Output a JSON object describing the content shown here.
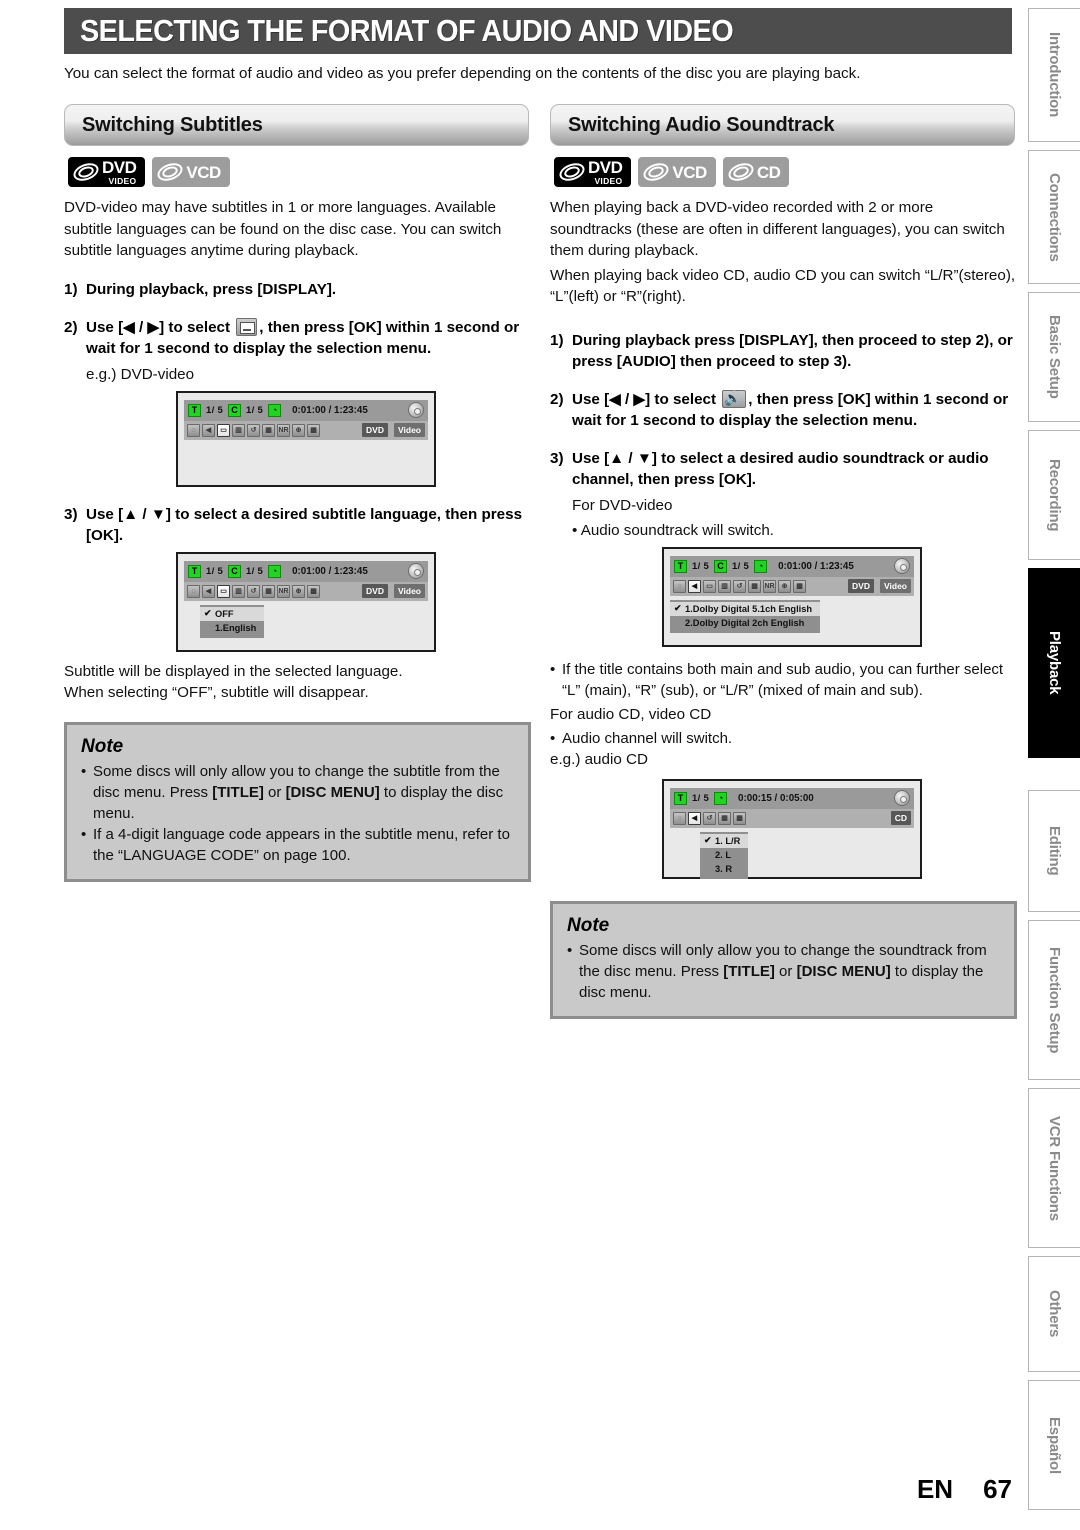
{
  "header": {
    "title": "SELECTING THE FORMAT OF AUDIO AND VIDEO",
    "intro": "You can select the format of audio and video as you prefer depending on the contents of the disc you are playing back."
  },
  "left_column": {
    "section_title": "Switching Subtitles",
    "disc_badges": [
      {
        "main": "DVD",
        "sub": "VIDEO",
        "style": "dark"
      },
      {
        "main": "VCD",
        "sub": "",
        "style": "gray"
      }
    ],
    "intro_paragraph": "DVD-video may have subtitles in 1 or more languages. Available subtitle languages can be found on the disc case. You can switch subtitle languages anytime during playback.",
    "steps": [
      {
        "num": "1)",
        "text_a": "During playback, press [DISPLAY].",
        "icon": "",
        "text_b": ""
      },
      {
        "num": "2)",
        "text_a": "Use [◀ / ▶] to select ",
        "icon": "subtitle-icon",
        "text_b": ", then press [OK] within 1 second or wait for 1 second to display the selection menu."
      },
      {
        "num": "3)",
        "text_a": "Use [▲ / ▼] to select a desired subtitle language, then press [OK].",
        "icon": "",
        "text_b": ""
      }
    ],
    "eg_label_1": "e.g.) DVD-video",
    "osd_1": {
      "title_chip": "T",
      "title_value": "1/  5",
      "chapter_chip": "C",
      "chapter_value": "1/  5",
      "clock_chip": "◔",
      "time": "0:01:00 / 1:23:45",
      "tags": [
        "DVD",
        "Video"
      ],
      "icons": [
        "angle-icon",
        "audio-icon",
        "subtitle-icon",
        "camera-icon",
        "repeat-icon",
        "marker-icon",
        "NR",
        "zoom-icon",
        "picture-icon"
      ],
      "active_icon_index": 2
    },
    "osd_2": {
      "title_chip": "T",
      "title_value": "1/  5",
      "chapter_chip": "C",
      "chapter_value": "1/  5",
      "clock_chip": "◔",
      "time": "0:01:00 / 1:23:45",
      "tags": [
        "DVD",
        "Video"
      ],
      "icons": [
        "angle-icon",
        "audio-icon",
        "subtitle-icon",
        "camera-icon",
        "repeat-icon",
        "marker-icon",
        "NR",
        "zoom-icon",
        "picture-icon"
      ],
      "active_icon_index": 2,
      "menu": [
        {
          "check": "✔",
          "label": "OFF",
          "selected": true
        },
        {
          "check": "",
          "label": "1.English",
          "selected": false
        }
      ]
    },
    "after_text_1": "Subtitle will be displayed in the selected language.",
    "after_text_2": "When selecting “OFF”, subtitle will disappear.",
    "note": {
      "title": "Note",
      "items": [
        "Some discs will only allow you to change the subtitle from the disc menu. Press [TITLE] or [DISC MENU] to display the disc menu.",
        "If a 4-digit language code appears in the subtitle menu, refer to the “LANGUAGE CODE” on page 100."
      ]
    }
  },
  "right_column": {
    "section_title": "Switching Audio Soundtrack",
    "disc_badges": [
      {
        "main": "DVD",
        "sub": "VIDEO",
        "style": "dark"
      },
      {
        "main": "VCD",
        "sub": "",
        "style": "gray"
      },
      {
        "main": "CD",
        "sub": "",
        "style": "gray"
      }
    ],
    "intro_paragraph_1": "When playing back a DVD-video recorded with 2 or more soundtracks (these are often in different languages), you can switch them during playback.",
    "intro_paragraph_2": "When playing back video CD, audio CD you can switch “L/R”(stereo), “L”(left) or “R”(right).",
    "steps": [
      {
        "num": "1)",
        "text_a": "During playback press [DISPLAY], then proceed to step 2), or press [AUDIO] then proceed to step 3).",
        "icon": "",
        "text_b": ""
      },
      {
        "num": "2)",
        "text_a": "Use [◀ / ▶] to select ",
        "icon": "audio-icon",
        "text_b": ", then press [OK] within 1 second or wait for 1 second to display the selection menu."
      },
      {
        "num": "3)",
        "text_a": "Use [▲ / ▼] to select a desired audio soundtrack or audio channel, then press [OK].",
        "icon": "",
        "text_b": ""
      }
    ],
    "for_dvd_label": "For DVD-video",
    "bullet_dvd": "Audio soundtrack will switch.",
    "osd_dvd": {
      "title_chip": "T",
      "title_value": "1/  5",
      "chapter_chip": "C",
      "chapter_value": "1/  5",
      "clock_chip": "◔",
      "time": "0:01:00 / 1:23:45",
      "tags": [
        "DVD",
        "Video"
      ],
      "icons": [
        "angle-icon",
        "audio-icon",
        "subtitle-icon",
        "camera-icon",
        "repeat-icon",
        "marker-icon",
        "NR",
        "zoom-icon",
        "picture-icon"
      ],
      "active_icon_index": 1,
      "menu": [
        {
          "check": "✔",
          "label": "1.Dolby Digital  5.1ch English",
          "selected": true
        },
        {
          "check": "",
          "label": "2.Dolby Digital    2ch English",
          "selected": false
        }
      ]
    },
    "bullet_main_sub": "If the title contains both main and sub audio, you can further select “L” (main), “R” (sub), or “L/R” (mixed of main and sub).",
    "for_cd_label": "For audio CD, video CD",
    "bullet_cd": "Audio channel will switch.",
    "eg_label_cd": "e.g.) audio CD",
    "osd_cd": {
      "title_chip": "T",
      "title_value": "1/  5",
      "clock_chip": "◔",
      "time": "0:00:15 / 0:05:00",
      "tags": [
        "CD"
      ],
      "icons": [
        "angle-icon",
        "audio-icon",
        "repeat-icon",
        "marker-icon",
        "picture-icon"
      ],
      "active_icon_index": 1,
      "menu": [
        {
          "check": "✔",
          "label": "1. L/R",
          "selected": true
        },
        {
          "check": "",
          "label": "2. L",
          "selected": false
        },
        {
          "check": "",
          "label": "3. R",
          "selected": false
        }
      ]
    },
    "note": {
      "title": "Note",
      "items": [
        "Some discs will only allow you to change the soundtrack from the disc menu. Press [TITLE] or [DISC MENU] to display the disc menu."
      ]
    }
  },
  "side_tabs": [
    {
      "label": "Introduction",
      "active": false
    },
    {
      "label": "Connections",
      "active": false
    },
    {
      "label": "Basic Setup",
      "active": false
    },
    {
      "label": "Recording",
      "active": false
    },
    {
      "label": "Playback",
      "active": true
    },
    {
      "label": "Editing",
      "active": false
    },
    {
      "label": "Function Setup",
      "active": false
    },
    {
      "label": "VCR Functions",
      "active": false
    },
    {
      "label": "Others",
      "active": false
    },
    {
      "label": "Español",
      "active": false
    }
  ],
  "footer": {
    "language_code": "EN",
    "page_number": "67"
  }
}
